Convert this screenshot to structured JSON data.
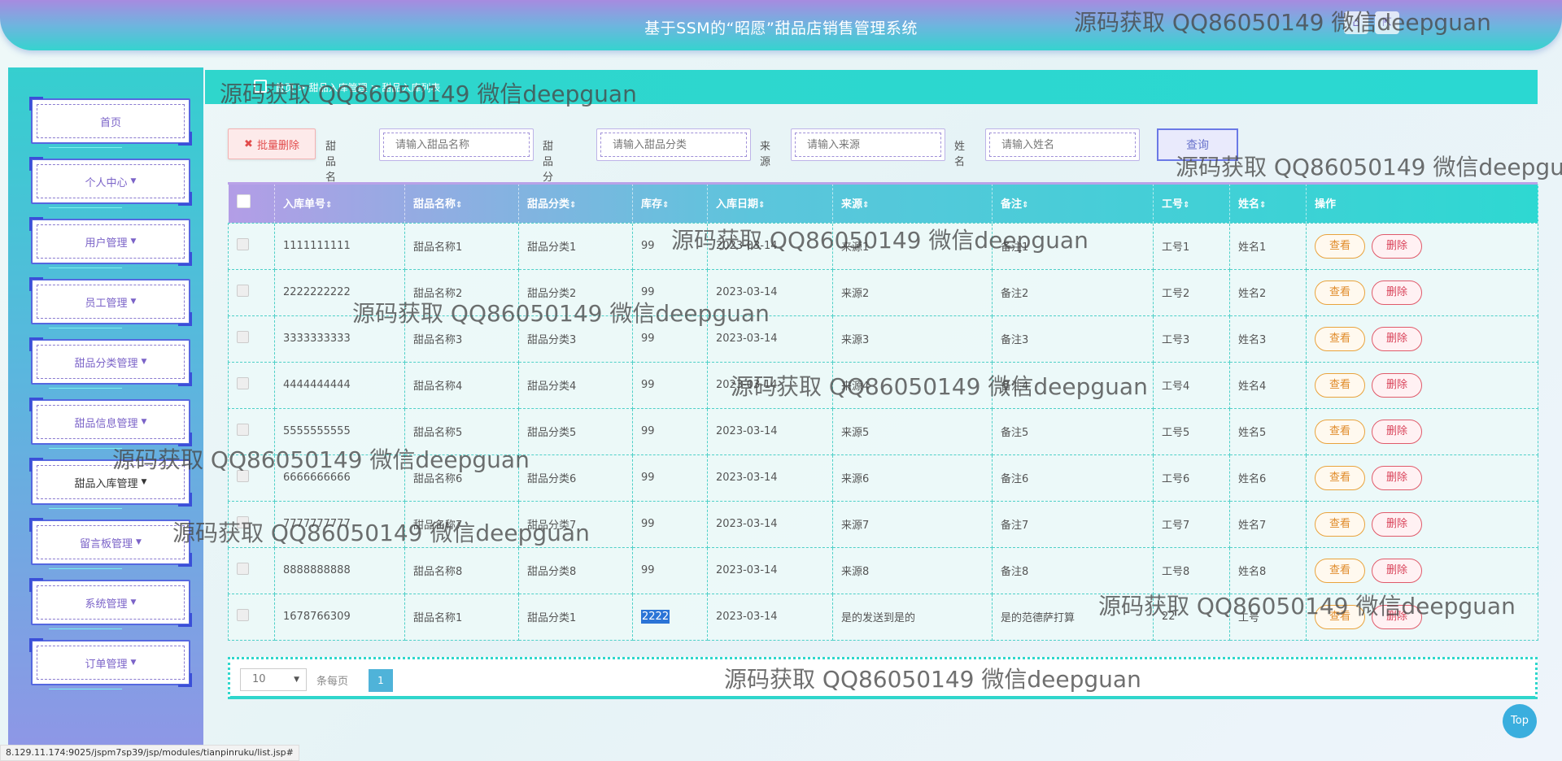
{
  "header": {
    "title": "基于SSM的“昭愿”甜品店销售管理系统",
    "btn1": "⌂",
    "btn2": "⇱"
  },
  "sidebar": {
    "items": [
      {
        "label": "首页",
        "has_caret": false
      },
      {
        "label": "个人中心",
        "has_caret": true
      },
      {
        "label": "用户管理",
        "has_caret": true
      },
      {
        "label": "员工管理",
        "has_caret": true
      },
      {
        "label": "甜品分类管理",
        "has_caret": true
      },
      {
        "label": "甜品信息管理",
        "has_caret": true
      },
      {
        "label": "甜品入库管理",
        "has_caret": true
      },
      {
        "label": "留言板管理",
        "has_caret": true
      },
      {
        "label": "系统管理",
        "has_caret": true
      },
      {
        "label": "订单管理",
        "has_caret": true
      }
    ]
  },
  "breadcrumb": {
    "text": "首页 > 甜品入库管理 > 甜品入库列表"
  },
  "search": {
    "batch_delete": "批量删除",
    "fields": [
      {
        "label": "甜品名称",
        "placeholder": "请输入甜品名称"
      },
      {
        "label": "甜品分类",
        "placeholder": "请输入甜品分类"
      },
      {
        "label": "来源",
        "placeholder": "请输入来源"
      },
      {
        "label": "姓名",
        "placeholder": "请输入姓名"
      }
    ],
    "query_button": "查询"
  },
  "table": {
    "columns": [
      "入库单号",
      "甜品名称",
      "甜品分类",
      "库存",
      "入库日期",
      "来源",
      "备注",
      "工号",
      "姓名",
      "操作"
    ],
    "rows": [
      [
        "1111111111",
        "甜品名称1",
        "甜品分类1",
        "99",
        "2023-03-14",
        "来源1",
        "备注1",
        "工号1",
        "姓名1"
      ],
      [
        "2222222222",
        "甜品名称2",
        "甜品分类2",
        "99",
        "2023-03-14",
        "来源2",
        "备注2",
        "工号2",
        "姓名2"
      ],
      [
        "3333333333",
        "甜品名称3",
        "甜品分类3",
        "99",
        "2023-03-14",
        "来源3",
        "备注3",
        "工号3",
        "姓名3"
      ],
      [
        "4444444444",
        "甜品名称4",
        "甜品分类4",
        "99",
        "2023-03-14",
        "来源4",
        "备注4",
        "工号4",
        "姓名4"
      ],
      [
        "5555555555",
        "甜品名称5",
        "甜品分类5",
        "99",
        "2023-03-14",
        "来源5",
        "备注5",
        "工号5",
        "姓名5"
      ],
      [
        "6666666666",
        "甜品名称6",
        "甜品分类6",
        "99",
        "2023-03-14",
        "来源6",
        "备注6",
        "工号6",
        "姓名6"
      ],
      [
        "7777777777",
        "甜品名称7",
        "甜品分类7",
        "99",
        "2023-03-14",
        "来源7",
        "备注7",
        "工号7",
        "姓名7"
      ],
      [
        "8888888888",
        "甜品名称8",
        "甜品分类8",
        "99",
        "2023-03-14",
        "来源8",
        "备注8",
        "工号8",
        "姓名8"
      ],
      [
        "1678766309",
        "甜品名称1",
        "甜品分类1",
        "2222",
        "2023-03-14",
        "是的发送到是的",
        "是的范德萨打算",
        "22",
        "工号"
      ]
    ],
    "view_label": "查看",
    "delete_label": "删除"
  },
  "pagination": {
    "page_size": "10",
    "per_page_label": "条每页",
    "current_page": "1"
  },
  "status_url": "8.129.11.174:9025/jspm7sp39/jsp/modules/tianpinruku/list.jsp#",
  "top_button": "Top",
  "watermark": "源码获取 QQ86050149 微信deepguan",
  "colors": {
    "accent_teal": "#2fd6cc",
    "accent_purple": "#b39de6",
    "view_orange": "#e08b2a",
    "delete_red": "#d9435a"
  }
}
